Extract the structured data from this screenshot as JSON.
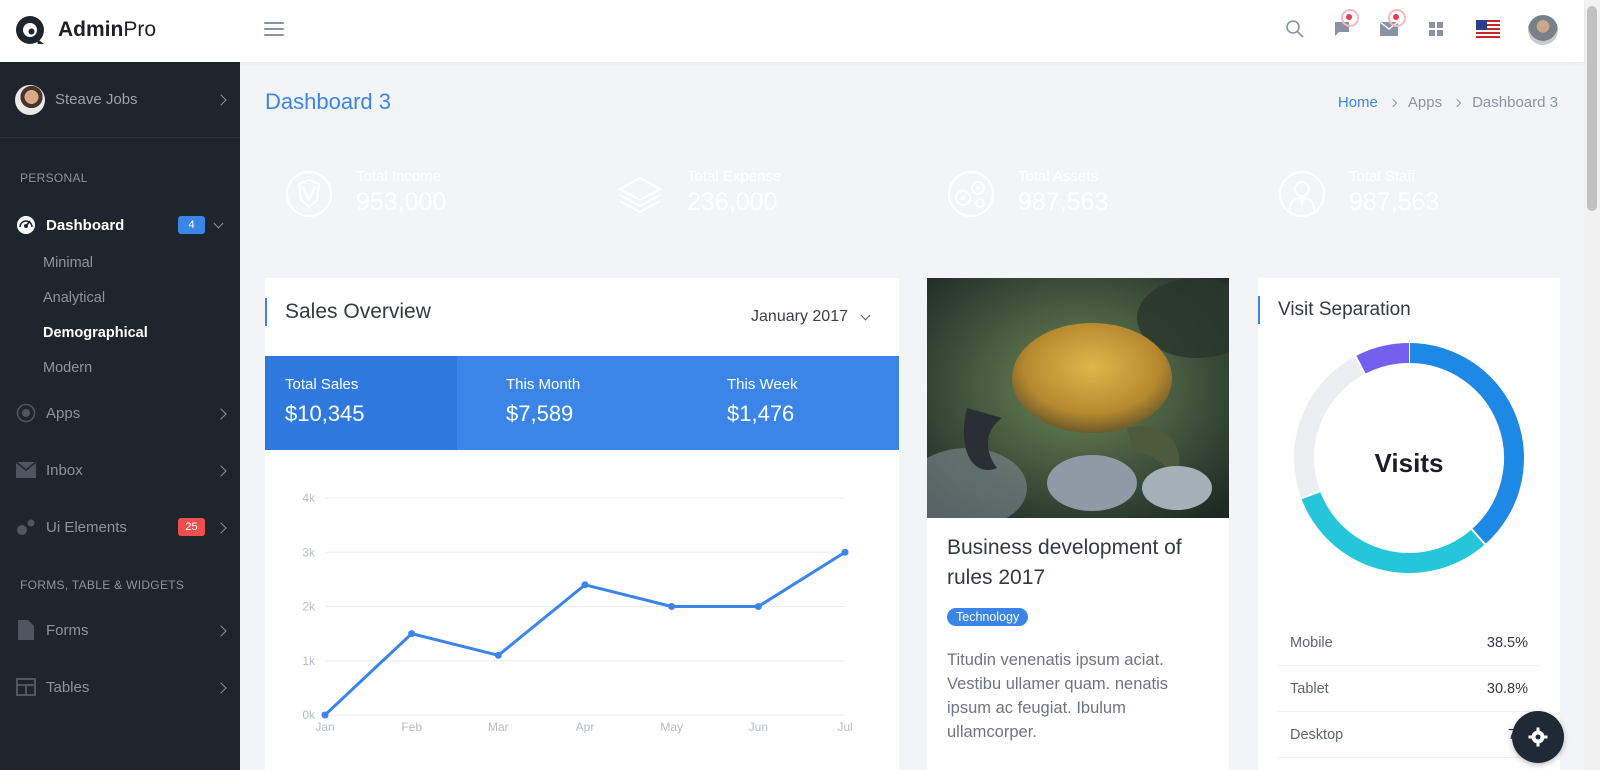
{
  "brand": {
    "bold": "Admin",
    "light": "Pro"
  },
  "header": {
    "icons": [
      "hamburger-icon",
      "search-icon",
      "chat-icon",
      "mail-icon",
      "apps-grid-icon",
      "us-flag-icon",
      "user-avatar"
    ]
  },
  "sidebar": {
    "user_name": "Steave Jobs",
    "section_personal": "PERSONAL",
    "dashboard": {
      "label": "Dashboard",
      "badge": "4",
      "badge_color": "#3b85e8"
    },
    "sub_items": [
      "Minimal",
      "Analytical",
      "Demographical",
      "Modern"
    ],
    "active_sub": "Demographical",
    "apps": "Apps",
    "inbox": "Inbox",
    "ui_elements": {
      "label": "Ui Elements",
      "badge": "25",
      "badge_color": "#ef4e4e"
    },
    "section_forms": "FORMS, TABLE & WIDGETS",
    "forms": "Forms",
    "tables": "Tables"
  },
  "page": {
    "title": "Dashboard 3",
    "breadcrumb": [
      "Home",
      "Apps",
      "Dashboard 3"
    ]
  },
  "stats": [
    {
      "label": "Total Income",
      "value": "953,000",
      "color": "#3b8bf0",
      "icon": "crest-icon"
    },
    {
      "label": "Total Expense",
      "value": "236,000",
      "color": "#06d59a",
      "icon": "layers-icon"
    },
    {
      "label": "Total Assets",
      "value": "987,563",
      "color": "#7d5cf3",
      "icon": "gears-icon"
    },
    {
      "label": "Total Staff",
      "value": "987,563",
      "color": "#ef5350",
      "icon": "staff-icon"
    }
  ],
  "sales": {
    "title": "Sales Overview",
    "month": "January 2017",
    "total_sales": {
      "label": "Total Sales",
      "value": "$10,345"
    },
    "this_month": {
      "label": "This Month",
      "value": "$7,589"
    },
    "this_week": {
      "label": "This Week",
      "value": "$1,476"
    }
  },
  "chart_data": {
    "type": "line",
    "categories": [
      "Jan",
      "Feb",
      "Mar",
      "Apr",
      "May",
      "Jun",
      "Jul"
    ],
    "series": [
      {
        "values": [
          0,
          1500,
          1100,
          2400,
          2000,
          2000,
          3000
        ]
      }
    ],
    "y_ticks": [
      "0k",
      "1k",
      "2k",
      "3k",
      "4k"
    ],
    "ylim": [
      0,
      4000
    ],
    "grid": true,
    "color": "#3b85e8"
  },
  "blog": {
    "title": "Business development of rules 2017",
    "tag": "Technology",
    "text": "Titudin venenatis ipsum aciat. Vestibu ullamer quam. nenatis ipsum ac feugiat. Ibulum ullamcorper."
  },
  "visits": {
    "title": "Visit Separation",
    "center_label": "Visits",
    "legend": [
      {
        "label": "Mobile",
        "value": "38.5%"
      },
      {
        "label": "Tablet",
        "value": "30.8%"
      },
      {
        "label": "Desktop",
        "value": "7.7"
      }
    ],
    "colors": {
      "mobile": "#1e88e5",
      "tablet": "#26c6da",
      "desktop": "#7460ee",
      "rest": "#eceff1"
    }
  }
}
